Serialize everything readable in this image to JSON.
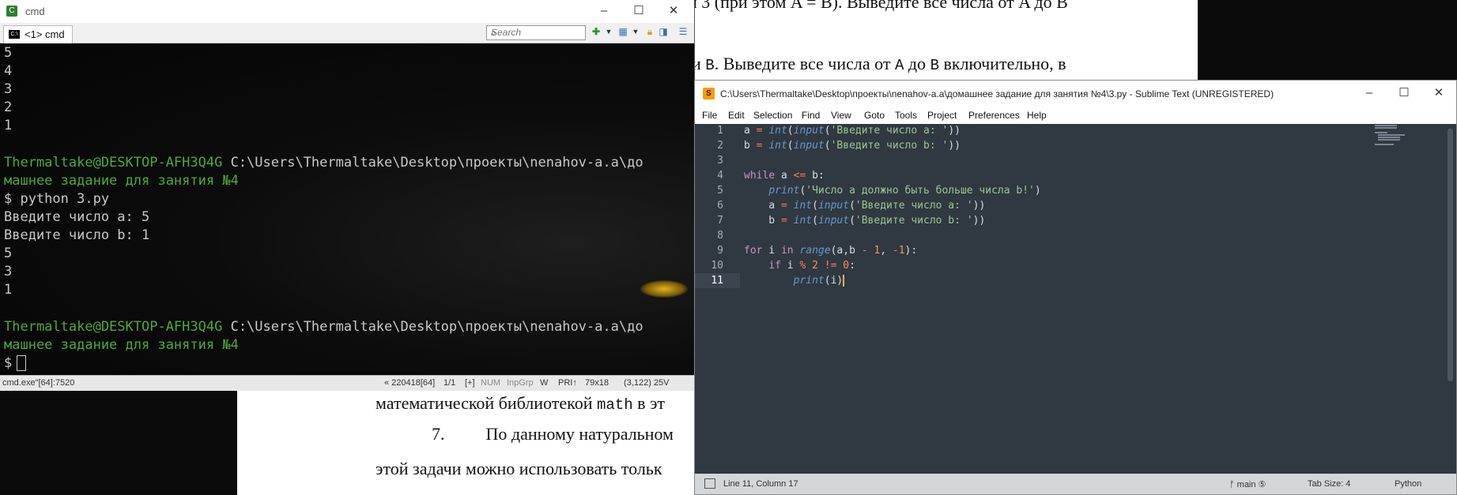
{
  "document": {
    "line1": "и 3 (при этом A = B). Выведите все числа от A до B",
    "line2_pre": "и ",
    "line2_code1": "B",
    "line2_mid": ". Выведите все числа от ",
    "line2_code2": "A",
    "line2_mid2": " до ",
    "line2_code3": "B",
    "line2_post": " включительно, в",
    "line3_pre": "математической библиотекой ",
    "line3_code": "math",
    "line3_post": " в эт",
    "line4_num": "7.",
    "line4_text": "По данному натуральном",
    "line5": "этой задачи можно использовать тольк"
  },
  "cmd": {
    "title": "cmd",
    "tab_label": "<1> cmd",
    "search_placeholder": "Search",
    "lines": {
      "l1": "5",
      "l2": "4",
      "l3": "3",
      "l4": "2",
      "l5": "1",
      "prompt1_user": "Thermaltake@DESKTOP-AFH3Q4G",
      "prompt1_path": " C:\\Users\\Thermaltake\\Desktop\\проекты\\nenahov-a.a\\до",
      "prompt1_cont": "машнее задание для занятия №4",
      "cmd1": "$ python 3.py",
      "in1": "Введите число a: 5",
      "in2": "Введите число b: 1",
      "o1": "5",
      "o2": "3",
      "o3": "1",
      "prompt2_user": "Thermaltake@DESKTOP-AFH3Q4G",
      "prompt2_path": " C:\\Users\\Thermaltake\\Desktop\\проекты\\nenahov-a.a\\до",
      "prompt2_cont": "машнее задание для занятия №4",
      "prompt_dollar": "$"
    },
    "status": {
      "process": "cmd.exe\"[64]:7520",
      "info": "« 220418[64]",
      "pages": "1/1",
      "plus": "[+]",
      "num": "NUM",
      "inpgrp": "InpGrp",
      "w": "W",
      "pri": "PRI↑",
      "size": "79x18",
      "cursor": "(3,122) 25V"
    }
  },
  "sublime": {
    "title": "C:\\Users\\Thermaltake\\Desktop\\проекты\\nenahov-a.a\\домашнее задание для занятия №4\\3.py - Sublime Text (UNREGISTERED)",
    "menu": [
      "File",
      "Edit",
      "Selection",
      "Find",
      "View",
      "Goto",
      "Tools",
      "Project",
      "Preferences",
      "Help"
    ],
    "line_numbers": [
      "1",
      "2",
      "3",
      "4",
      "5",
      "6",
      "7",
      "8",
      "9",
      "10",
      "11"
    ],
    "code": {
      "s_prompt_a": "'Введите число a: '",
      "s_prompt_b": "'Введите число b: '",
      "s_msg": "'Число a должно быть больше числа b!'",
      "kw_while": "while",
      "kw_for": "for",
      "kw_in": "in",
      "kw_if": "if",
      "f_int": "int",
      "f_input": "input",
      "f_print": "print",
      "f_range": "range"
    },
    "status": {
      "position": "Line 11, Column 17",
      "branch": "ᚠ main ⑤",
      "tab_size": "Tab Size: 4",
      "syntax": "Python"
    }
  }
}
